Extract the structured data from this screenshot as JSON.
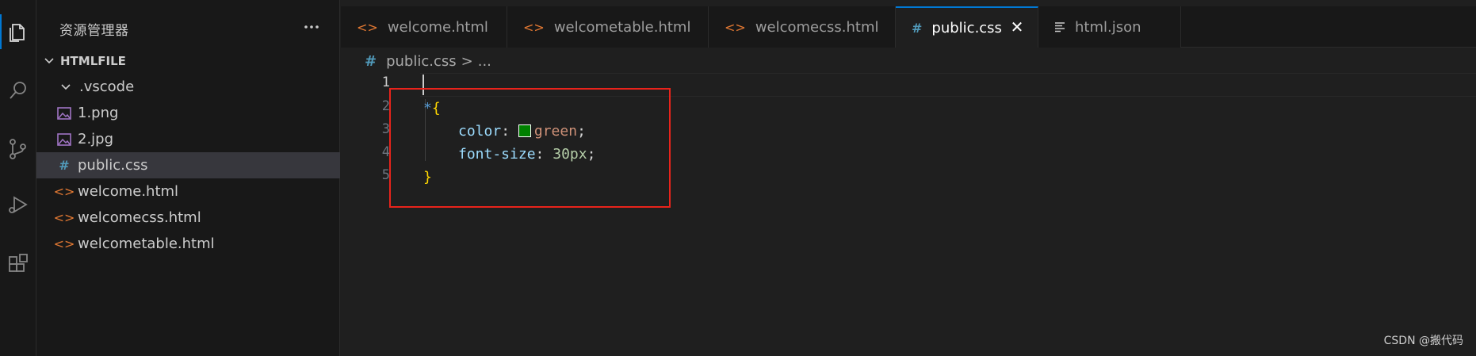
{
  "activity_bar": {
    "icons": [
      "files-icon",
      "search-icon",
      "source-control-icon",
      "run-debug-icon",
      "extensions-icon"
    ]
  },
  "sidebar": {
    "title": "资源管理器",
    "more_label": "···",
    "folder": "HTMLFILE",
    "items": [
      {
        "label": ".vscode",
        "icon": "chevron-down-icon"
      },
      {
        "label": "1.png",
        "icon": "image-icon"
      },
      {
        "label": "2.jpg",
        "icon": "image-icon"
      },
      {
        "label": "public.css",
        "icon": "hash-icon",
        "selected": true
      },
      {
        "label": "welcome.html",
        "icon": "html-icon"
      },
      {
        "label": "welcomecss.html",
        "icon": "html-icon"
      },
      {
        "label": "welcometable.html",
        "icon": "html-icon"
      }
    ]
  },
  "tabs": [
    {
      "label": "welcome.html",
      "icon": "html-icon"
    },
    {
      "label": "welcometable.html",
      "icon": "html-icon"
    },
    {
      "label": "welcomecss.html",
      "icon": "html-icon"
    },
    {
      "label": "public.css",
      "icon": "hash-icon",
      "active": true,
      "close": "✕"
    },
    {
      "label": "html.json",
      "icon": "json-icon"
    }
  ],
  "breadcrumb": {
    "hash": "#",
    "file": "public.css",
    "separator": ">",
    "more": "..."
  },
  "editor": {
    "line_numbers": [
      "1",
      "2",
      "3",
      "4",
      "5"
    ],
    "code": {
      "selector": "*",
      "open_brace": "{",
      "prop1": "color",
      "colon1": ":",
      "val1": "green",
      "semi1": ";",
      "prop2": "font-size",
      "colon2": ":",
      "val2": "30px",
      "semi2": ";",
      "close_brace": "}"
    },
    "swatch_color": "#008000"
  },
  "watermark": "CSDN @搬代码",
  "colors": {
    "accent": "#0078d4",
    "highlight_box": "#e8231b",
    "html_icon": "#e37933",
    "css_icon": "#519aba",
    "image_icon": "#a074c4"
  }
}
